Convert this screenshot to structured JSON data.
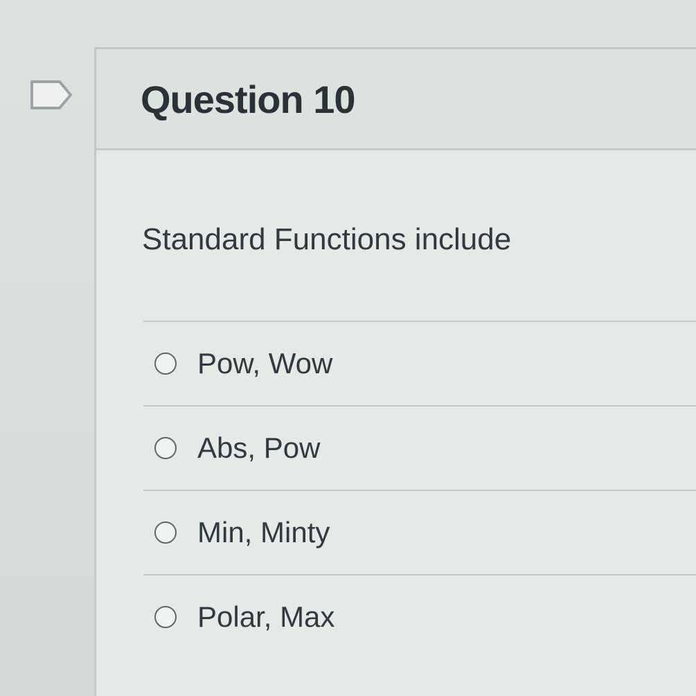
{
  "flag": {
    "icon": "flag-icon"
  },
  "question": {
    "title": "Question 10",
    "text": "Standard Functions include",
    "answers": [
      {
        "label": "Pow, Wow",
        "selected": false
      },
      {
        "label": "Abs, Pow",
        "selected": false
      },
      {
        "label": "Min, Minty",
        "selected": false
      },
      {
        "label": "Polar, Max",
        "selected": false
      }
    ]
  },
  "colors": {
    "background": "#d6dcd8",
    "text": "#2d3b45",
    "divider": "#c4cbc7"
  }
}
